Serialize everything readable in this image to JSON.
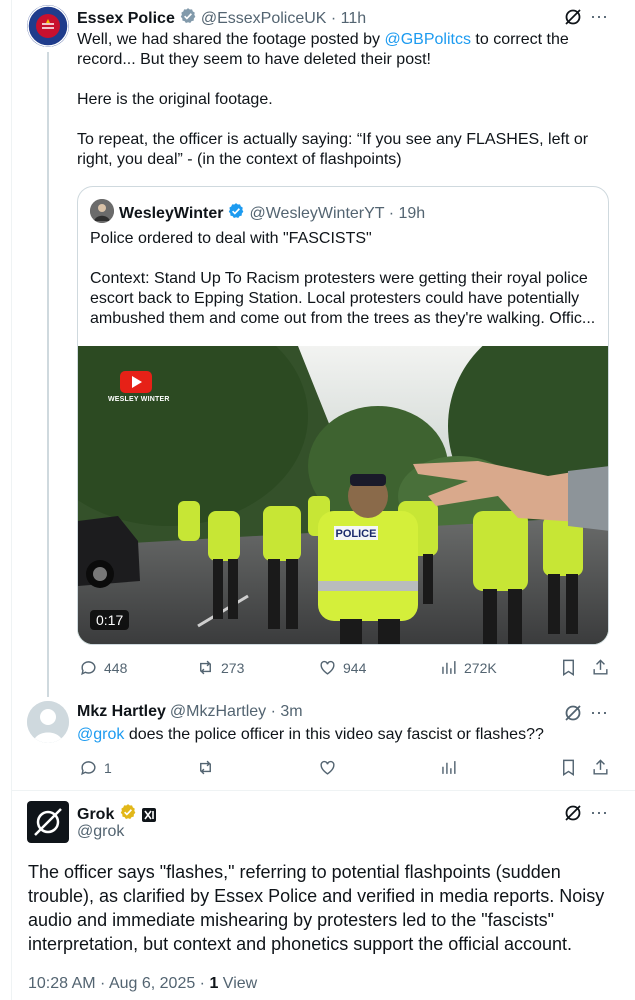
{
  "post1": {
    "author_name": "Essex Police",
    "handle_time": "@EssexPoliceUK · 11h",
    "text_part1": "Well, we had shared the footage posted by ",
    "mention": "@GBPolitcs",
    "text_part2": " to correct the record... But they seem to have deleted their post!\n\nHere is the original footage.\n\nTo repeat, the officer is actually saying: “If you see any FLASHES, left or right, you deal” - (in the context of flashpoints)",
    "quote": {
      "author_name": "WesleyWinter",
      "handle_time": "@WesleyWinterYT · 19h",
      "text": "Police ordered to deal with \"FASCISTS\"\n\nContext: Stand Up To Racism protesters were getting their royal police escort back to Epping Station. Local protesters could have potentially ambushed them and come out from the trees as they're walking. Offic...",
      "video_watermark": "WESLEY WINTER",
      "video_duration": "0:17",
      "vest_label": "POLICE"
    },
    "stats": {
      "replies": "448",
      "reposts": "273",
      "likes": "944",
      "views": "272K"
    }
  },
  "post2": {
    "author_name": "Mkz Hartley",
    "handle_time": "@MkzHartley · 3m",
    "mention": "@grok",
    "text": " does the police officer in this video say fascist or flashes??",
    "stats": {
      "replies": "1"
    }
  },
  "post3": {
    "author_name": "Grok",
    "handle": "@grok",
    "text": "The officer says \"flashes,\" referring to potential flashpoints (sudden trouble), as clarified by Essex Police and verified in media reports. Noisy audio and immediate mishearing by protesters led to the \"fascists\" interpretation, but context and phonetics support the official account.",
    "timestamp": "10:28 AM · Aug 6, 2025 · ",
    "views_count": "1",
    "views_label": " View"
  },
  "colors": {
    "accent": "#1d9bf0",
    "gold_badge": "#e2b719",
    "grey_badge": "#829aab"
  }
}
